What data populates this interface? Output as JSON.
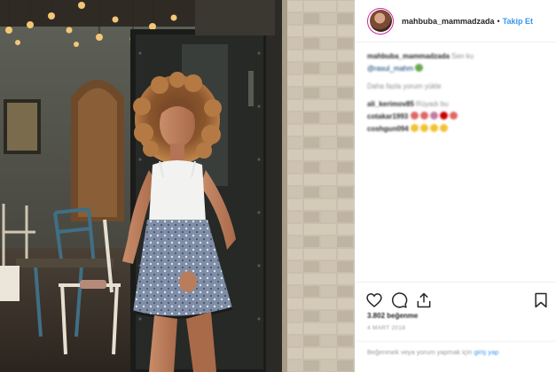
{
  "post": {
    "username": "mahbuba_mammadzada",
    "separator": "•",
    "follow_label": "Takip Et",
    "comments": [
      {
        "user": "mahbuba_mammadzada",
        "text": "Sen ku",
        "mention": "@rasul_mahm"
      },
      {
        "user": "",
        "text": "Daha fazla yorum yükle",
        "mention": ""
      },
      {
        "user": "ali_kerimov85",
        "text": "Rüyadı bu",
        "mention": ""
      },
      {
        "user": "cotakar1993",
        "text": "",
        "mention": ""
      },
      {
        "user": "coshgun094",
        "text": "",
        "mention": ""
      }
    ],
    "likes": "3.802 beğenme",
    "time_ago": "4 MART 2018",
    "login_text": "Beğenmek veya yorum yapmak için",
    "login_link": "giriş yap"
  },
  "colors": {
    "follow": "#3897f0",
    "avatar_ring": "#d6249f",
    "text": "#262626",
    "muted": "#8e8e8e"
  },
  "icons": [
    "heart-icon",
    "comment-icon",
    "share-icon",
    "bookmark-icon"
  ]
}
